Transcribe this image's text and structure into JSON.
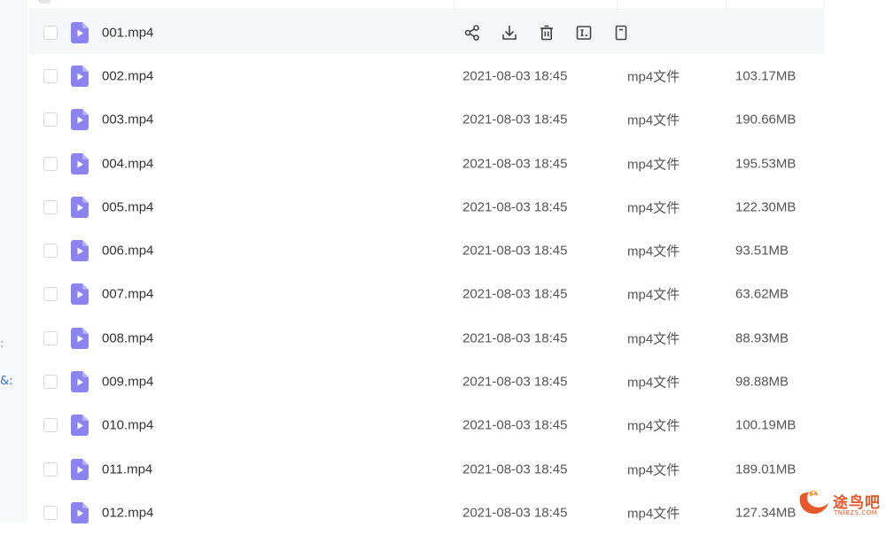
{
  "sidebar": {
    "fragments": [
      ":",
      "&:"
    ]
  },
  "file_list": {
    "hovered_actions": [
      "share-icon",
      "download-icon",
      "delete-icon",
      "rename-icon",
      "more-icon"
    ],
    "rows": [
      {
        "name": "001.mp4",
        "date": "",
        "type": "",
        "size": "",
        "hovered": true
      },
      {
        "name": "002.mp4",
        "date": "2021-08-03 18:45",
        "type": "mp4文件",
        "size": "103.17MB"
      },
      {
        "name": "003.mp4",
        "date": "2021-08-03 18:45",
        "type": "mp4文件",
        "size": "190.66MB"
      },
      {
        "name": "004.mp4",
        "date": "2021-08-03 18:45",
        "type": "mp4文件",
        "size": "195.53MB"
      },
      {
        "name": "005.mp4",
        "date": "2021-08-03 18:45",
        "type": "mp4文件",
        "size": "122.30MB"
      },
      {
        "name": "006.mp4",
        "date": "2021-08-03 18:45",
        "type": "mp4文件",
        "size": "93.51MB"
      },
      {
        "name": "007.mp4",
        "date": "2021-08-03 18:45",
        "type": "mp4文件",
        "size": "63.62MB"
      },
      {
        "name": "008.mp4",
        "date": "2021-08-03 18:45",
        "type": "mp4文件",
        "size": "88.93MB"
      },
      {
        "name": "009.mp4",
        "date": "2021-08-03 18:45",
        "type": "mp4文件",
        "size": "98.88MB"
      },
      {
        "name": "010.mp4",
        "date": "2021-08-03 18:45",
        "type": "mp4文件",
        "size": "100.19MB"
      },
      {
        "name": "011.mp4",
        "date": "2021-08-03 18:45",
        "type": "mp4文件",
        "size": "189.01MB"
      },
      {
        "name": "012.mp4",
        "date": "2021-08-03 18:45",
        "type": "mp4文件",
        "size": "127.34MB"
      }
    ]
  },
  "colors": {
    "file_icon": "#8b84f0",
    "hover_bg": "#f5f6f8",
    "watermark": "#e8572a"
  },
  "watermark": {
    "text": "途鸟吧",
    "subtext": "TNIBZS.COM"
  }
}
